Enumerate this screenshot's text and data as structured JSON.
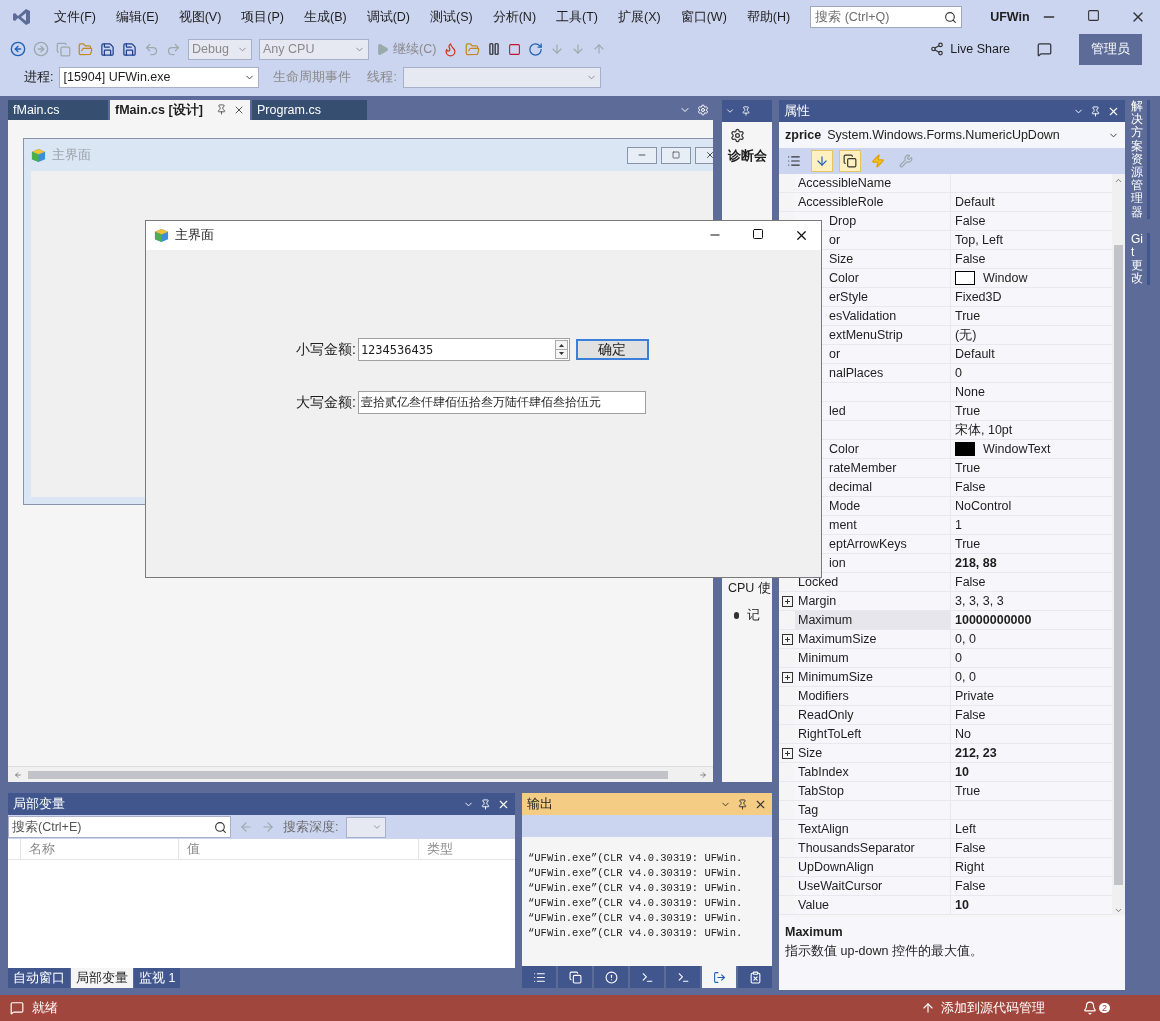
{
  "menu": [
    "文件(F)",
    "编辑(E)",
    "视图(V)",
    "项目(P)",
    "生成(B)",
    "调试(D)",
    "测试(S)",
    "分析(N)",
    "工具(T)",
    "扩展(X)",
    "窗口(W)",
    "帮助(H)"
  ],
  "search": {
    "placeholder": "搜索 (Ctrl+Q)"
  },
  "app_title": "UFWin",
  "toolbar": {
    "config": "Debug",
    "platform": "Any CPU",
    "continue": "继续(C)",
    "live_share": "Live Share",
    "admin_badge": "管理员"
  },
  "debug_bar": {
    "process_label": "进程:",
    "process": "[15904] UFWin.exe",
    "lifecycle": "生命周期事件",
    "thread_label": "线程:"
  },
  "doc_tabs": [
    {
      "label": "fMain.cs",
      "selected": false
    },
    {
      "label": "fMain.cs [设计]",
      "selected": true
    },
    {
      "label": "Program.cs",
      "selected": false
    }
  ],
  "designer_form": {
    "title": "主界面"
  },
  "running_form": {
    "title": "主界面",
    "fields": [
      {
        "kind": "spinner",
        "label": "小写金额:",
        "value": "1234536435"
      },
      {
        "kind": "text",
        "label": "大写金额:",
        "value": "壹拾贰亿叁仟肆佰伍拾叁万陆仟肆佰叁拾伍元"
      }
    ],
    "button": "确定"
  },
  "diag_panel": {
    "title": "诊断会",
    "section": "CPU 使",
    "item": "记"
  },
  "properties": {
    "title": "属性",
    "object_name": "zprice",
    "object_type": "System.Windows.Forms.NumericUpDown",
    "rows": [
      {
        "name": "AccessibleName",
        "selected": false
      },
      {
        "name": "AccessibleRole",
        "value": "Default",
        "selected": false
      },
      {
        "name": "Drop",
        "clipped": true,
        "value": "False",
        "selected": false
      },
      {
        "name": "or",
        "clipped": true,
        "value": "Top, Left",
        "selected": false
      },
      {
        "name": "Size",
        "clipped": true,
        "value": "False",
        "selected": false
      },
      {
        "name": "Color",
        "clipped": true,
        "value": "Window",
        "color": "#ffffff",
        "selected": false
      },
      {
        "name": "erStyle",
        "clipped": true,
        "value": "Fixed3D",
        "selected": false
      },
      {
        "name": "esValidation",
        "clipped": true,
        "value": "True",
        "selected": false
      },
      {
        "name": "extMenuStrip",
        "clipped": true,
        "value": "(无)",
        "selected": false
      },
      {
        "name": "or",
        "clipped": true,
        "value": "Default",
        "selected": false
      },
      {
        "name": "nalPlaces",
        "clipped": true,
        "value": "0",
        "selected": false
      },
      {
        "value": "None",
        "selected": false
      },
      {
        "name": "led",
        "clipped": true,
        "value": "True",
        "selected": false
      },
      {
        "value": "宋体, 10pt",
        "selected": false
      },
      {
        "name": "Color",
        "clipped": true,
        "value": "WindowText",
        "color": "#000000",
        "selected": false
      },
      {
        "name": "rateMember",
        "clipped": true,
        "value": "True",
        "selected": false
      },
      {
        "name": "decimal",
        "clipped": true,
        "value": "False",
        "selected": false
      },
      {
        "name": "Mode",
        "clipped": true,
        "value": "NoControl",
        "selected": false
      },
      {
        "name": "ment",
        "clipped": true,
        "value": "1",
        "selected": false
      },
      {
        "name": "eptArrowKeys",
        "clipped": true,
        "value": "True",
        "selected": false
      },
      {
        "name": "ion",
        "clipped": true,
        "value": "218, 88",
        "bold": true,
        "selected": false
      },
      {
        "name": "Locked",
        "value": "False",
        "selected": false
      },
      {
        "name": "Margin",
        "expandable": true,
        "value": "3, 3, 3, 3",
        "selected": false
      },
      {
        "name": "Maximum",
        "value": "10000000000",
        "bold": true,
        "selected": true
      },
      {
        "name": "MaximumSize",
        "expandable": true,
        "value": "0, 0",
        "selected": false
      },
      {
        "name": "Minimum",
        "value": "0",
        "selected": false
      },
      {
        "name": "MinimumSize",
        "expandable": true,
        "value": "0, 0",
        "selected": false
      },
      {
        "name": "Modifiers",
        "value": "Private",
        "selected": false
      },
      {
        "name": "ReadOnly",
        "value": "False",
        "selected": false
      },
      {
        "name": "RightToLeft",
        "value": "No",
        "selected": false
      },
      {
        "name": "Size",
        "expandable": true,
        "value": "212, 23",
        "bold": true,
        "selected": false
      },
      {
        "name": "TabIndex",
        "value": "10",
        "bold": true,
        "selected": false
      },
      {
        "name": "TabStop",
        "value": "True",
        "selected": false
      },
      {
        "name": "Tag",
        "selected": false
      },
      {
        "name": "TextAlign",
        "value": "Left",
        "selected": false
      },
      {
        "name": "ThousandsSeparator",
        "value": "False",
        "selected": false
      },
      {
        "name": "UpDownAlign",
        "value": "Right",
        "selected": false
      },
      {
        "name": "UseWaitCursor",
        "value": "False",
        "selected": false
      },
      {
        "name": "Value",
        "value": "10",
        "bold": true,
        "selected": false
      }
    ],
    "description_title": "Maximum",
    "description": "指示数值 up-down 控件的最大值。"
  },
  "right_tabs": [
    "解决方案资源管理器",
    "Git 更改"
  ],
  "locals": {
    "title": "局部变量",
    "search_placeholder": "搜索(Ctrl+E)",
    "depth_label": "搜索深度:",
    "columns": [
      "名称",
      "值",
      "类型"
    ],
    "tabs": [
      {
        "label": "自动窗口",
        "selected": false
      },
      {
        "label": "局部变量",
        "selected": true
      },
      {
        "label": "监视 1",
        "selected": false
      }
    ]
  },
  "output": {
    "title": "输出",
    "tool_tabs": [
      {
        "selected": false
      },
      {
        "selected": false
      },
      {
        "selected": false
      },
      {
        "selected": false
      },
      {
        "selected": false
      },
      {
        "selected": true
      },
      {
        "selected": false
      }
    ],
    "lines": [
      "“UFWin.exe”(CLR v4.0.30319: UFWin.",
      "“UFWin.exe”(CLR v4.0.30319: UFWin.",
      "“UFWin.exe”(CLR v4.0.30319: UFWin.",
      "“UFWin.exe”(CLR v4.0.30319: UFWin.",
      "“UFWin.exe”(CLR v4.0.30319: UFWin.",
      "“UFWin.exe”(CLR v4.0.30319: UFWin."
    ]
  },
  "status": {
    "text": "就绪",
    "source_control": "添加到源代码管理",
    "notifications": "2"
  }
}
